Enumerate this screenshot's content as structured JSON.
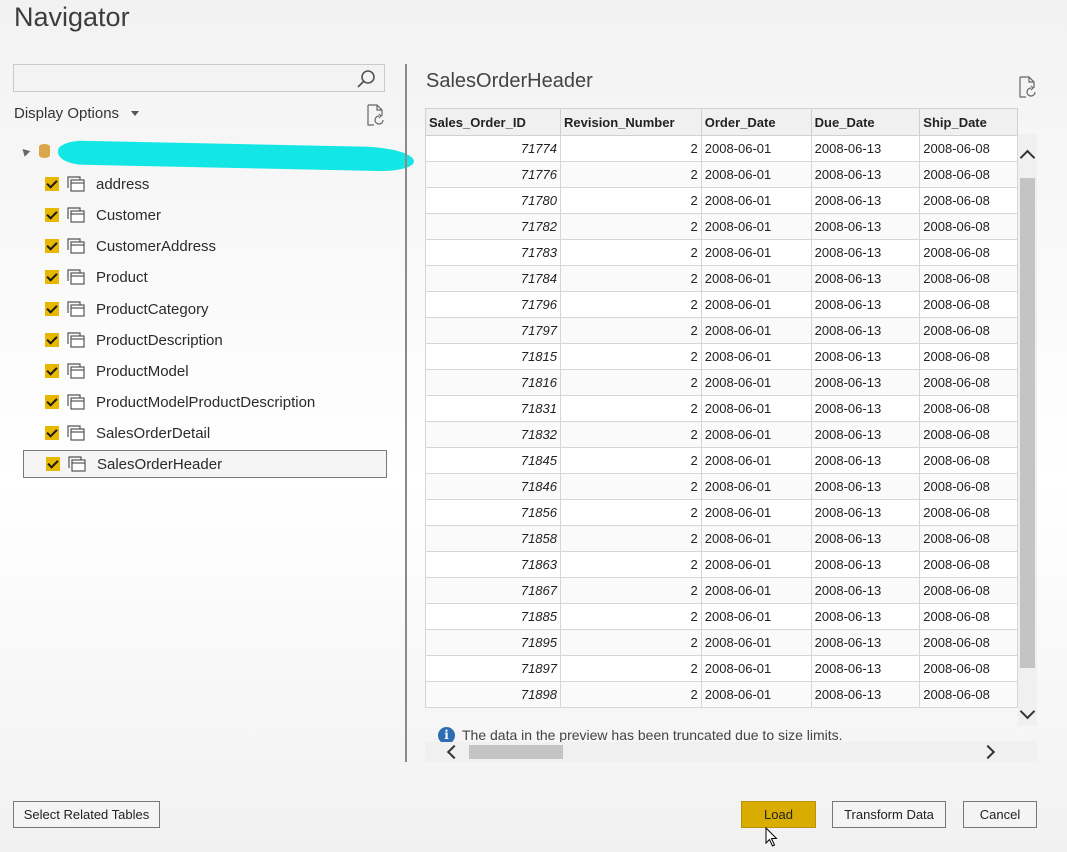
{
  "window": {
    "title": "Navigator"
  },
  "search": {
    "value": "",
    "placeholder": ""
  },
  "display_options": {
    "label": "Display Options"
  },
  "tree": {
    "root_label": "",
    "items": [
      {
        "label": "address",
        "checked": true
      },
      {
        "label": "Customer",
        "checked": true
      },
      {
        "label": "CustomerAddress",
        "checked": true
      },
      {
        "label": "Product",
        "checked": true
      },
      {
        "label": "ProductCategory",
        "checked": true
      },
      {
        "label": "ProductDescription",
        "checked": true
      },
      {
        "label": "ProductModel",
        "checked": true
      },
      {
        "label": "ProductModelProductDescription",
        "checked": true
      },
      {
        "label": "SalesOrderDetail",
        "checked": true
      },
      {
        "label": "SalesOrderHeader",
        "checked": true,
        "selected": true
      }
    ]
  },
  "preview": {
    "title": "SalesOrderHeader",
    "columns": [
      "Sales_Order_ID",
      "Revision_Number",
      "Order_Date",
      "Due_Date",
      "Ship_Date"
    ],
    "rows": [
      [
        "71774",
        "2",
        "2008-06-01",
        "2008-06-13",
        "2008-06-08"
      ],
      [
        "71776",
        "2",
        "2008-06-01",
        "2008-06-13",
        "2008-06-08"
      ],
      [
        "71780",
        "2",
        "2008-06-01",
        "2008-06-13",
        "2008-06-08"
      ],
      [
        "71782",
        "2",
        "2008-06-01",
        "2008-06-13",
        "2008-06-08"
      ],
      [
        "71783",
        "2",
        "2008-06-01",
        "2008-06-13",
        "2008-06-08"
      ],
      [
        "71784",
        "2",
        "2008-06-01",
        "2008-06-13",
        "2008-06-08"
      ],
      [
        "71796",
        "2",
        "2008-06-01",
        "2008-06-13",
        "2008-06-08"
      ],
      [
        "71797",
        "2",
        "2008-06-01",
        "2008-06-13",
        "2008-06-08"
      ],
      [
        "71815",
        "2",
        "2008-06-01",
        "2008-06-13",
        "2008-06-08"
      ],
      [
        "71816",
        "2",
        "2008-06-01",
        "2008-06-13",
        "2008-06-08"
      ],
      [
        "71831",
        "2",
        "2008-06-01",
        "2008-06-13",
        "2008-06-08"
      ],
      [
        "71832",
        "2",
        "2008-06-01",
        "2008-06-13",
        "2008-06-08"
      ],
      [
        "71845",
        "2",
        "2008-06-01",
        "2008-06-13",
        "2008-06-08"
      ],
      [
        "71846",
        "2",
        "2008-06-01",
        "2008-06-13",
        "2008-06-08"
      ],
      [
        "71856",
        "2",
        "2008-06-01",
        "2008-06-13",
        "2008-06-08"
      ],
      [
        "71858",
        "2",
        "2008-06-01",
        "2008-06-13",
        "2008-06-08"
      ],
      [
        "71863",
        "2",
        "2008-06-01",
        "2008-06-13",
        "2008-06-08"
      ],
      [
        "71867",
        "2",
        "2008-06-01",
        "2008-06-13",
        "2008-06-08"
      ],
      [
        "71885",
        "2",
        "2008-06-01",
        "2008-06-13",
        "2008-06-08"
      ],
      [
        "71895",
        "2",
        "2008-06-01",
        "2008-06-13",
        "2008-06-08"
      ],
      [
        "71897",
        "2",
        "2008-06-01",
        "2008-06-13",
        "2008-06-08"
      ],
      [
        "71898",
        "2",
        "2008-06-01",
        "2008-06-13",
        "2008-06-08"
      ]
    ],
    "truncation_notice": "The data in the preview has been truncated due to size limits."
  },
  "buttons": {
    "select_related": "Select Related Tables",
    "load": "Load",
    "transform": "Transform Data",
    "cancel": "Cancel"
  },
  "colors": {
    "accent": "#d8ad00",
    "checkbox": "#e8b800",
    "redaction": "#14e6e6",
    "info": "#2d6db3"
  },
  "icons": {
    "search": "search-icon",
    "refresh": "refresh-icon",
    "table": "table-icon",
    "database": "database-icon",
    "info": "info-icon"
  }
}
